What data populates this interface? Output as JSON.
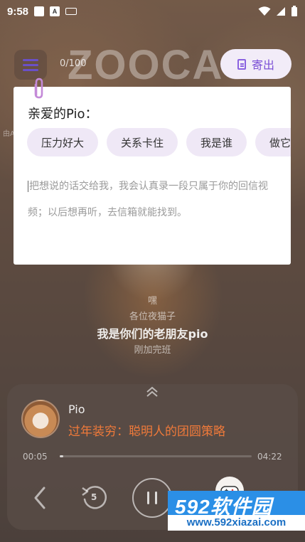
{
  "status_bar": {
    "time": "9:58",
    "notif_a": "A"
  },
  "header": {
    "counter": "0/100",
    "sign_text": "ZOOCAST",
    "send_label": "寄出"
  },
  "letter": {
    "greeting": "亲爱的Pio：",
    "chips": [
      "压力好大",
      "关系卡住",
      "我是谁",
      "做它"
    ],
    "placeholder": "把想说的话交给我，我会认真录一段只属于你的回信视频；以后想再听，去信箱就能找到。"
  },
  "side_text": "由AI生成",
  "subtitles": {
    "line1": "嘿",
    "line2": "各位夜猫子",
    "line3": "我是你们的老朋友pio",
    "line4": "刚加完班"
  },
  "player": {
    "artist": "Pio",
    "title": "过年装穷：聪明人的团圆策略",
    "current_time": "00:05",
    "total_time": "04:22",
    "progress": 0.02,
    "replay_seconds": "5"
  },
  "watermark": {
    "logo": "592软件园",
    "url": "www.592xiazai.com"
  },
  "colors": {
    "accent_purple": "#7b4fd6",
    "title_orange": "#f07a3a",
    "watermark_blue": "#2b8fe6"
  }
}
